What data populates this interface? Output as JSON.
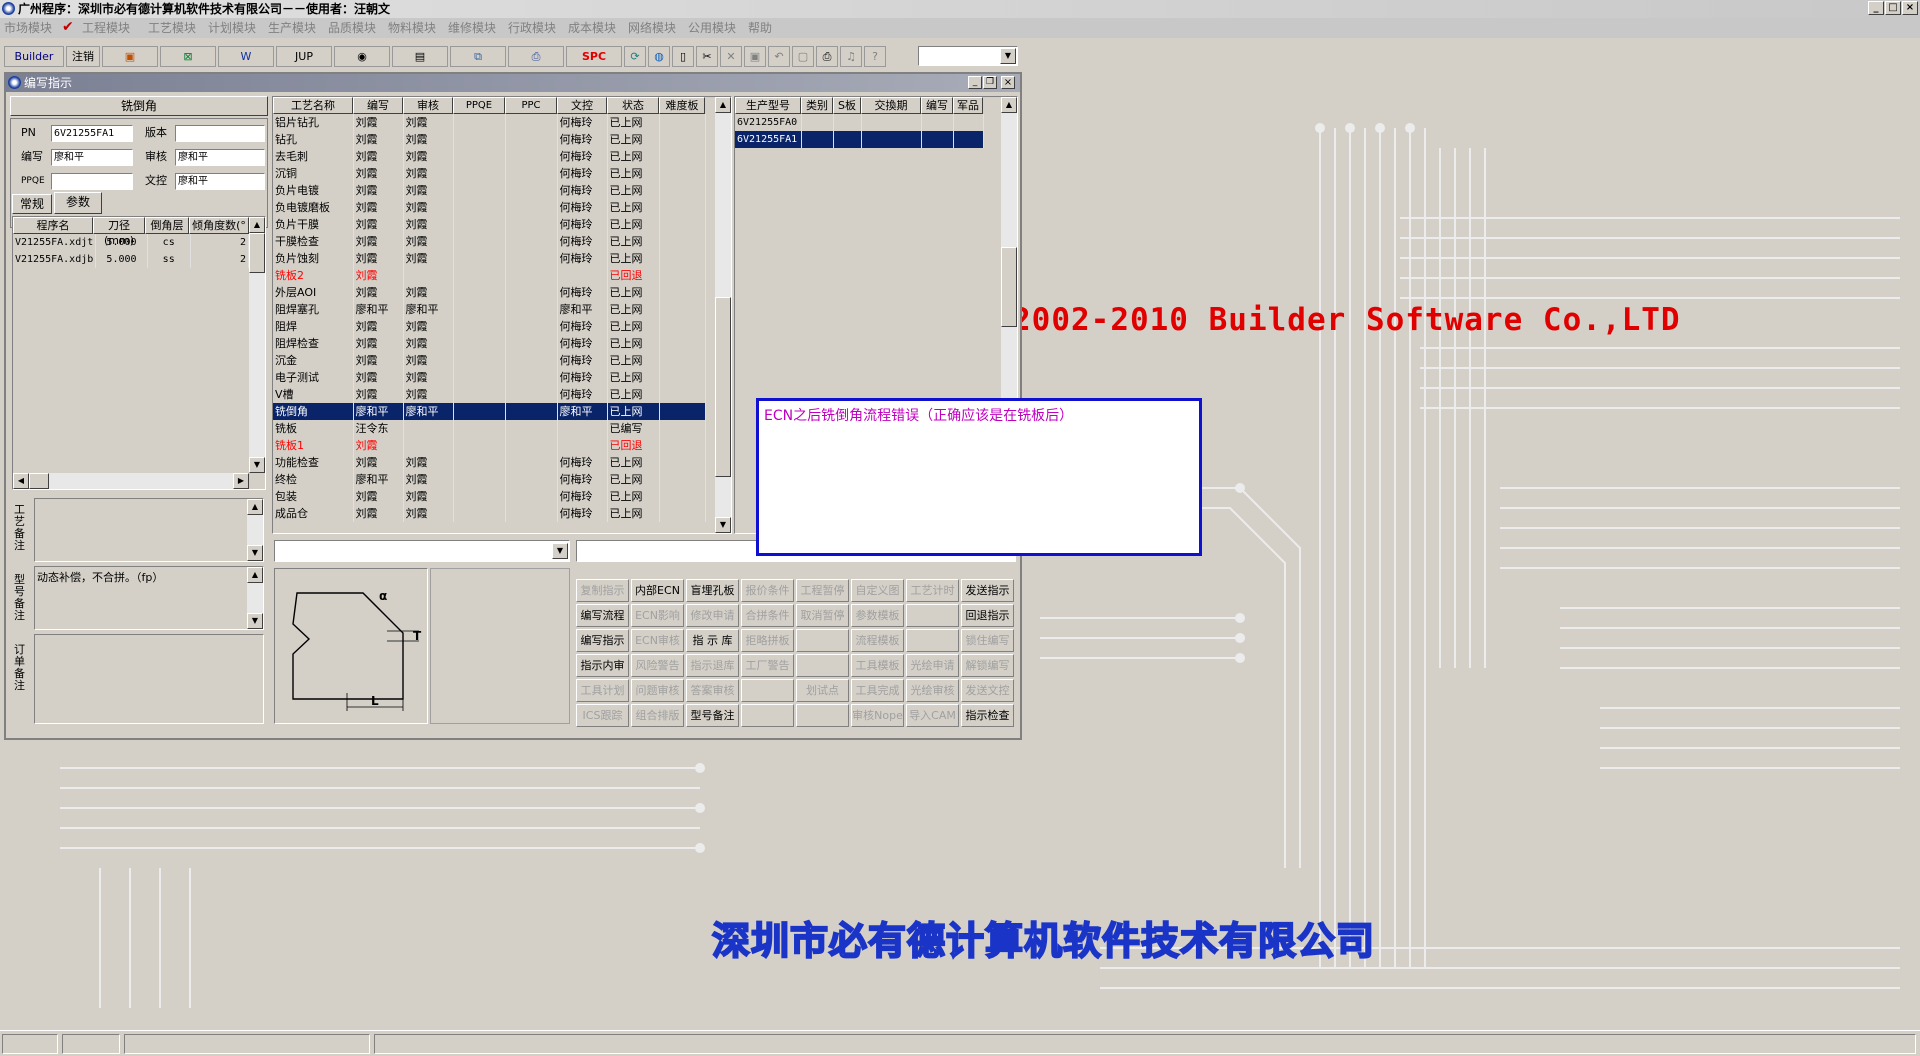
{
  "titlebar": {
    "title": "广州程序：深圳市必有德计算机软件技术有限公司－－使用者：汪朝文",
    "min": "_",
    "max": "□",
    "close": "×"
  },
  "menu": [
    "市场模块",
    "工程模块",
    "工艺模块",
    "计划模块",
    "生产模块",
    "品质模块",
    "物料模块",
    "维修模块",
    "行政模块",
    "成本模块",
    "网络模块",
    "公用模块",
    "帮助"
  ],
  "toolbar": {
    "builder": "Builder",
    "logout": "注销",
    "jup": "JUP",
    "spc": "SPC"
  },
  "desktop": {
    "copyright": "2002-2010 Builder Software Co.,LTD",
    "company": "深圳市必有德计算机软件技术有限公司",
    "colors": {
      "copyright": "#e00000",
      "company": "#1a34c8"
    }
  },
  "window": {
    "title": "编写指示",
    "panel_title": "铣倒角",
    "pn_label": "PN",
    "pn_value": "6V21255FA1",
    "version_label": "版本",
    "version_value": "",
    "writer_label": "编写",
    "writer_value": "廖和平",
    "review_label": "审核",
    "review_value": "廖和平",
    "ppqe_label": "PPQE",
    "ppqe_value": "",
    "doc_label": "文控",
    "doc_value": "廖和平",
    "tabs": [
      "常规",
      "参数"
    ],
    "prog_headers": [
      "程序名",
      "刀径(mm)",
      "倒角层",
      "倾角度数(°"
    ],
    "prog_rows": [
      [
        "V21255FA.xdjt",
        "5.000",
        "cs",
        "2"
      ],
      [
        "V21255FA.xdjb",
        "5.000",
        "ss",
        "2"
      ]
    ],
    "note1_label": "工艺备注",
    "note2_label": "型号备注",
    "note2_text": "动态补偿，不合拼。（fp）",
    "note3_label": "订单备注",
    "proc_headers": [
      "工艺名称",
      "编写",
      "审核",
      "PPQE",
      "PPC",
      "文控",
      "状态",
      "难度板"
    ],
    "proc_rows": [
      [
        "铝片钻孔",
        "刘霞",
        "刘霞",
        "",
        "",
        "何梅玲",
        "已上网",
        ""
      ],
      [
        "钻孔",
        "刘霞",
        "刘霞",
        "",
        "",
        "何梅玲",
        "已上网",
        ""
      ],
      [
        "去毛刺",
        "刘霞",
        "刘霞",
        "",
        "",
        "何梅玲",
        "已上网",
        ""
      ],
      [
        "沉铜",
        "刘霞",
        "刘霞",
        "",
        "",
        "何梅玲",
        "已上网",
        ""
      ],
      [
        "负片电镀",
        "刘霞",
        "刘霞",
        "",
        "",
        "何梅玲",
        "已上网",
        ""
      ],
      [
        "负电镀磨板",
        "刘霞",
        "刘霞",
        "",
        "",
        "何梅玲",
        "已上网",
        ""
      ],
      [
        "负片干膜",
        "刘霞",
        "刘霞",
        "",
        "",
        "何梅玲",
        "已上网",
        ""
      ],
      [
        "干膜检查",
        "刘霞",
        "刘霞",
        "",
        "",
        "何梅玲",
        "已上网",
        ""
      ],
      [
        "负片蚀刻",
        "刘霞",
        "刘霞",
        "",
        "",
        "何梅玲",
        "已上网",
        ""
      ],
      [
        "铣板2",
        "刘霞",
        "",
        "",
        "",
        "",
        "已回退",
        ""
      ],
      [
        "外层AOI",
        "刘霞",
        "刘霞",
        "",
        "",
        "何梅玲",
        "已上网",
        ""
      ],
      [
        "阻焊塞孔",
        "廖和平",
        "廖和平",
        "",
        "",
        "廖和平",
        "已上网",
        ""
      ],
      [
        "阻焊",
        "刘霞",
        "刘霞",
        "",
        "",
        "何梅玲",
        "已上网",
        ""
      ],
      [
        "阻焊检查",
        "刘霞",
        "刘霞",
        "",
        "",
        "何梅玲",
        "已上网",
        ""
      ],
      [
        "沉金",
        "刘霞",
        "刘霞",
        "",
        "",
        "何梅玲",
        "已上网",
        ""
      ],
      [
        "电子测试",
        "刘霞",
        "刘霞",
        "",
        "",
        "何梅玲",
        "已上网",
        ""
      ],
      [
        "V槽",
        "刘霞",
        "刘霞",
        "",
        "",
        "何梅玲",
        "已上网",
        ""
      ],
      [
        "铣倒角",
        "廖和平",
        "廖和平",
        "",
        "",
        "廖和平",
        "已上网",
        ""
      ],
      [
        "铣板",
        "汪令东",
        "",
        "",
        "",
        "",
        "已编写",
        ""
      ],
      [
        "铣板1",
        "刘霞",
        "",
        "",
        "",
        "",
        "已回退",
        ""
      ],
      [
        "功能检查",
        "刘霞",
        "刘霞",
        "",
        "",
        "何梅玲",
        "已上网",
        ""
      ],
      [
        "终检",
        "廖和平",
        "刘霞",
        "",
        "",
        "何梅玲",
        "已上网",
        ""
      ],
      [
        "包装",
        "刘霞",
        "刘霞",
        "",
        "",
        "何梅玲",
        "已上网",
        ""
      ],
      [
        "成品仓",
        "刘霞",
        "刘霞",
        "",
        "",
        "何梅玲",
        "已上网",
        ""
      ]
    ],
    "model_headers": [
      "生产型号",
      "类别",
      "S板",
      "交換期",
      "编写",
      "军品"
    ],
    "model_rows": [
      [
        "6V21255FA0",
        "",
        "",
        "",
        "",
        ""
      ],
      [
        "6V21255FA1",
        "",
        "",
        "",
        "",
        ""
      ]
    ],
    "popup_text": "ECN之后铣倒角流程错误（正确应该是在铣板后）",
    "diagram": {
      "alpha": "α",
      "t": "T",
      "l": "L"
    },
    "buttons": [
      [
        "复制指示",
        "内部ECN",
        "盲埋孔板",
        "报价条件",
        "工程暂停",
        "自定义图",
        "工艺计时",
        "发送指示"
      ],
      [
        "编写流程",
        "ECN影响",
        "修改申请",
        "合拼条件",
        "取消暂停",
        "参数模板",
        "",
        "回退指示"
      ],
      [
        "编写指示",
        "ECN审核",
        "指 示 库",
        "拒略拼板",
        "",
        "流程模板",
        "",
        "锁住编写"
      ],
      [
        "指示内审",
        "风险警告",
        "指示退库",
        "工厂警告",
        "",
        "工具模板",
        "光绘申请",
        "解锁编写"
      ],
      [
        "工具计划",
        "问题审核",
        "答案审核",
        "",
        "划试点",
        "工具完成",
        "光绘审核",
        "发送文控"
      ],
      [
        "ICS跟踪",
        "组合排版",
        "型号备注",
        "",
        "",
        "审核Nope",
        "导入CAM",
        "指示检查"
      ]
    ],
    "buttons_enabled": [
      [
        false,
        true,
        true,
        false,
        false,
        false,
        false,
        true
      ],
      [
        true,
        false,
        false,
        false,
        false,
        false,
        false,
        true
      ],
      [
        true,
        false,
        true,
        false,
        false,
        false,
        false,
        false
      ],
      [
        true,
        false,
        false,
        false,
        false,
        false,
        false,
        false
      ],
      [
        false,
        false,
        false,
        false,
        false,
        false,
        false,
        false
      ],
      [
        false,
        false,
        true,
        false,
        false,
        false,
        false,
        true
      ]
    ]
  }
}
